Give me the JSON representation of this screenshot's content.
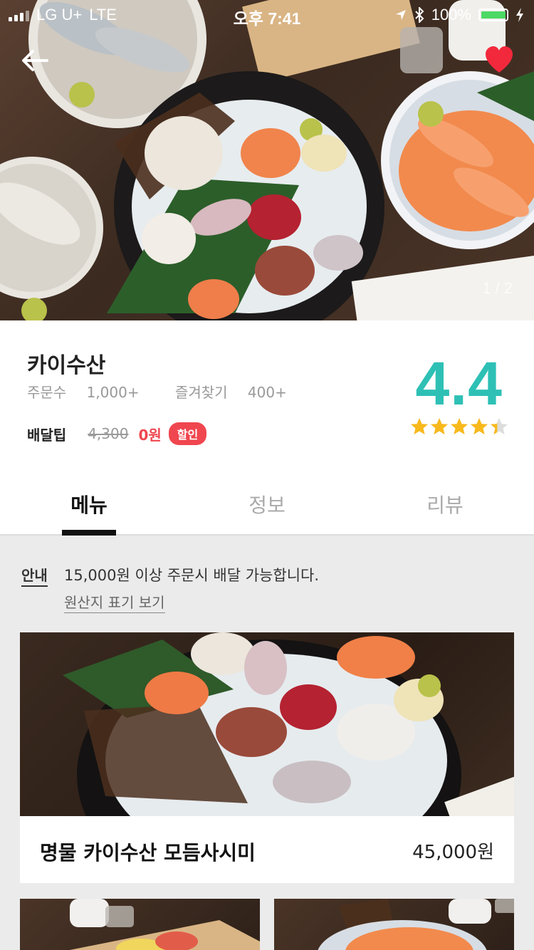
{
  "status_bar": {
    "carrier": "LG U+",
    "network": "LTE",
    "time": "오후 7:41",
    "battery": "100%"
  },
  "hero": {
    "page_indicator": "1 / 2"
  },
  "store": {
    "name": "카이수산",
    "orders_label": "주문수",
    "orders_value": "1,000+",
    "favorites_label": "즐겨찾기",
    "favorites_value": "400+",
    "delivery_label": "배달팁",
    "delivery_original": "4,300",
    "delivery_discounted": "0원",
    "discount_badge": "할인",
    "rating": "4.4",
    "rating_stars": 4.4
  },
  "tabs": [
    {
      "label": "메뉴",
      "active": true
    },
    {
      "label": "정보",
      "active": false
    },
    {
      "label": "리뷰",
      "active": false
    }
  ],
  "notice": {
    "label": "안내",
    "text": "15,000원 이상 주문시 배달 가능합니다.",
    "link": "원산지 표기 보기"
  },
  "menu": {
    "featured": {
      "name": "명물 카이수산 모듬사시미",
      "price": "45,000원"
    }
  },
  "colors": {
    "accent": "#2ec0b5",
    "discount": "#f0464f",
    "heart": "#f2293c",
    "star": "#f9b91c"
  }
}
